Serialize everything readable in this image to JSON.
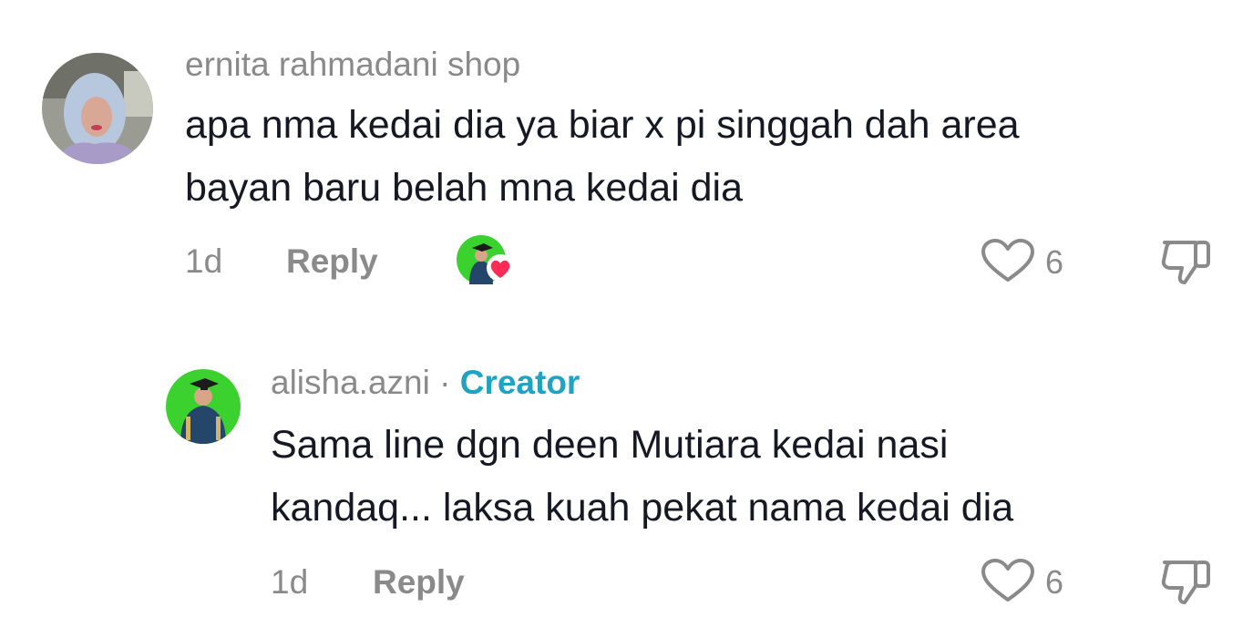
{
  "comments": [
    {
      "username": "ernita rahmadani shop",
      "text_line1": "apa nma kedai dia ya biar x pi singgah dah area",
      "text_line2": "bayan baru belah mna kedai dia",
      "time": "1d",
      "reply_label": "Reply",
      "like_count": "6"
    },
    {
      "username": "alisha.azni",
      "separator": "·",
      "badge": "Creator",
      "text_line1": "Sama line dgn deen Mutiara kedai nasi",
      "text_line2": "kandaq... laksa kuah pekat nama kedai dia",
      "time": "1d",
      "reply_label": "Reply",
      "like_count": "6"
    }
  ],
  "colors": {
    "text_primary": "#161823",
    "text_secondary": "#8a8a8a",
    "creator_badge": "#1fa3c4",
    "heart_badge": "#fe2c55",
    "avatar_green": "#3bd12e"
  },
  "icons": [
    "heart-outline-icon",
    "thumbs-down-icon",
    "creator-liked-heart-icon"
  ]
}
